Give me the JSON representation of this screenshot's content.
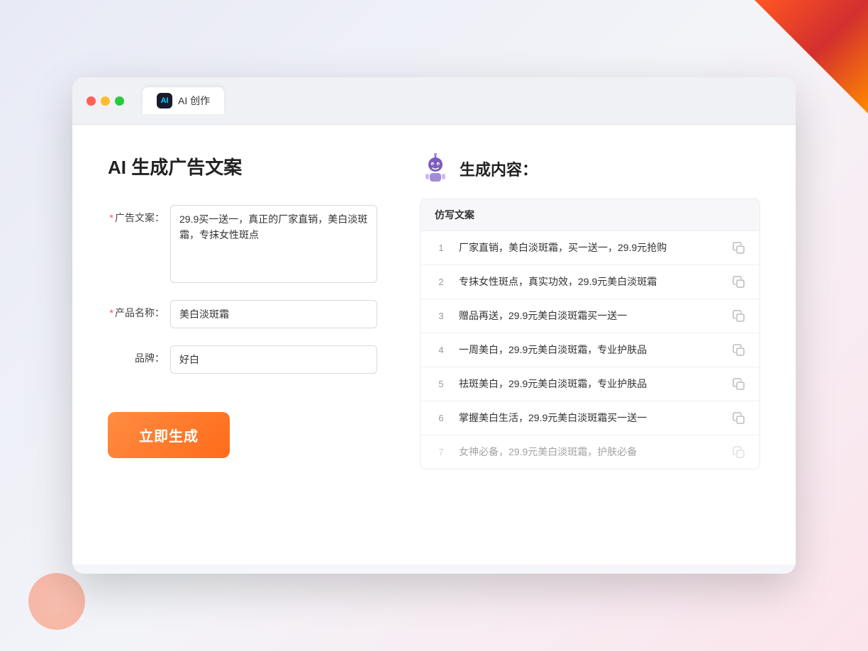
{
  "window": {
    "tab_label": "AI 创作",
    "tab_icon_text": "AI"
  },
  "left_panel": {
    "title": "AI 生成广告文案",
    "fields": {
      "ad_copy_label": "广告文案：",
      "ad_copy_required": "*",
      "ad_copy_value": "29.9买一送一，真正的厂家直销，美白淡斑霜，专抹女性斑点",
      "product_name_label": "产品名称：",
      "product_name_required": "*",
      "product_name_value": "美白淡斑霜",
      "brand_label": "品牌：",
      "brand_value": "好白"
    },
    "generate_btn": "立即生成"
  },
  "right_panel": {
    "header_title": "生成内容：",
    "table_header": "仿写文案",
    "rows": [
      {
        "num": "1",
        "text": "厂家直销，美白淡斑霜，买一送一，29.9元抢购",
        "faded": false
      },
      {
        "num": "2",
        "text": "专抹女性斑点，真实功效，29.9元美白淡斑霜",
        "faded": false
      },
      {
        "num": "3",
        "text": "赠品再送，29.9元美白淡斑霜买一送一",
        "faded": false
      },
      {
        "num": "4",
        "text": "一周美白，29.9元美白淡斑霜，专业护肤品",
        "faded": false
      },
      {
        "num": "5",
        "text": "祛斑美白，29.9元美白淡斑霜，专业护肤品",
        "faded": false
      },
      {
        "num": "6",
        "text": "掌握美白生活，29.9元美白淡斑霜买一送一",
        "faded": false
      },
      {
        "num": "7",
        "text": "女神必备，29.9元美白淡斑霜，护肤必备",
        "faded": true
      }
    ]
  }
}
